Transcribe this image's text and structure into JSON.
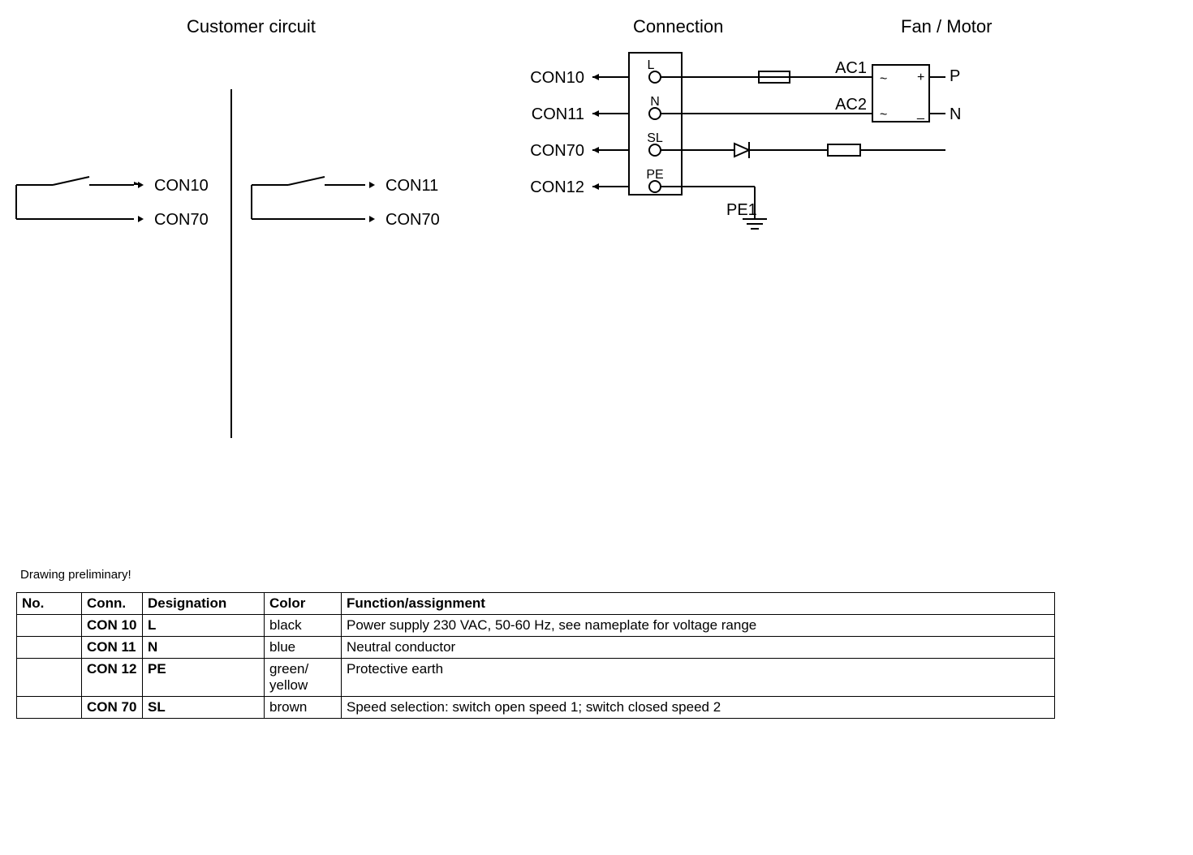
{
  "sections": {
    "customer": "Customer circuit",
    "connection": "Connection",
    "fanmotor": "Fan / Motor"
  },
  "customer": {
    "left": {
      "top": "CON10",
      "bottom": "CON70"
    },
    "right": {
      "top": "CON11",
      "bottom": "CON70"
    }
  },
  "connection": {
    "con10": "CON10",
    "con11": "CON11",
    "con70": "CON70",
    "con12": "CON12",
    "terminals": {
      "l": "L",
      "n": "N",
      "sl": "SL",
      "pe": "PE"
    },
    "ac1": "AC1",
    "ac2": "AC2",
    "pe1": "PE1",
    "p": "P",
    "nn": "N",
    "tilde1": "~",
    "tilde2": "~",
    "plus": "+",
    "minus": "_"
  },
  "note": "Drawing preliminary!",
  "table": {
    "headers": [
      "No.",
      "Conn.",
      "Designation",
      "Color",
      "Function/assignment"
    ],
    "rows": [
      {
        "no": "",
        "conn": "CON 10",
        "desig": "L",
        "color": "black",
        "func": "Power supply 230 VAC, 50-60 Hz, see nameplate for voltage range"
      },
      {
        "no": "",
        "conn": "CON 11",
        "desig": "N",
        "color": "blue",
        "func": "Neutral conductor"
      },
      {
        "no": "",
        "conn": "CON 12",
        "desig": "PE",
        "color": "green/ yellow",
        "func": "Protective earth"
      },
      {
        "no": "",
        "conn": "CON 70",
        "desig": "SL",
        "color": "brown",
        "func": "Speed selection: switch open speed 1; switch closed speed 2"
      }
    ]
  }
}
